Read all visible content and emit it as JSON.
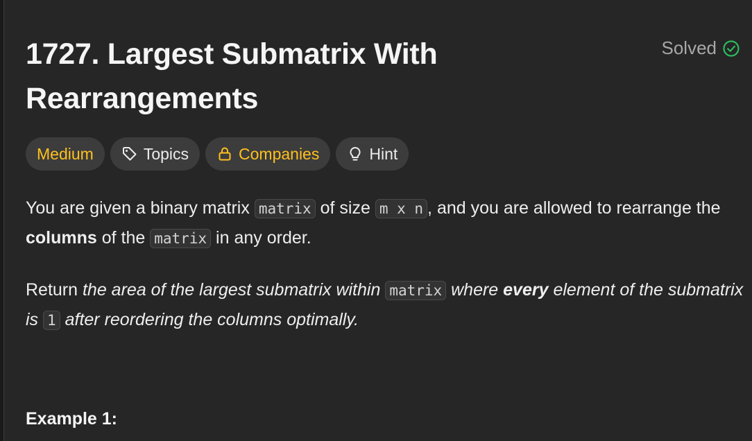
{
  "problem": {
    "number": "1727.",
    "title": "Largest Submatrix With Rearrangements",
    "status": "Solved"
  },
  "tags": {
    "difficulty": "Medium",
    "topics": "Topics",
    "companies": "Companies",
    "hint": "Hint"
  },
  "description": {
    "p1": {
      "t1": "You are given a binary matrix ",
      "c1": "matrix",
      "t2": " of size ",
      "c2": "m x n",
      "t3": ", and you are allowed to rearrange the ",
      "b1": "columns",
      "t4": " of the ",
      "c3": "matrix",
      "t5": " in any order."
    },
    "p2": {
      "t1": "Return ",
      "i1": "the area of the largest submatrix within ",
      "c1": "matrix",
      "i2": " where ",
      "bi1": "every",
      "i3": " element of the submatrix is ",
      "c2": "1",
      "i4": " after reordering the columns optimally."
    }
  },
  "example": {
    "heading": "Example 1:"
  },
  "colors": {
    "background": "#262626",
    "medium": "#ffc01e",
    "solved_check": "#2cbb5d",
    "tag_bg": "#3c3c3c"
  },
  "icons": {
    "solved": "check-circle-icon",
    "topics": "tag-icon",
    "companies": "lock-icon",
    "hint": "lightbulb-icon"
  }
}
